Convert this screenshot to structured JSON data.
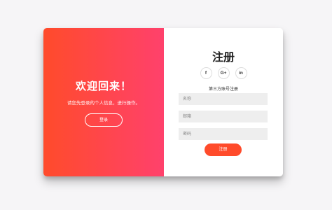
{
  "left_panel": {
    "title": "欢迎回来！",
    "subtitle": "请您先登录的个人信息，进行操作。",
    "login_button": "登录"
  },
  "right_panel": {
    "title": "注册",
    "socials": [
      {
        "label": "f",
        "icon": "facebook-icon"
      },
      {
        "label": "G+",
        "icon": "google-plus-icon"
      },
      {
        "label": "in",
        "icon": "linkedin-icon"
      }
    ],
    "alt_text": "第三方账号注册",
    "fields": {
      "name_placeholder": "名称",
      "email_placeholder": "邮箱",
      "password_placeholder": "密码"
    },
    "submit_button": "注册"
  },
  "colors": {
    "gradient_start": "#ff4b2b",
    "gradient_end": "#ff416c",
    "field_bg": "#eeeeee",
    "page_bg": "#f6f5f7"
  }
}
